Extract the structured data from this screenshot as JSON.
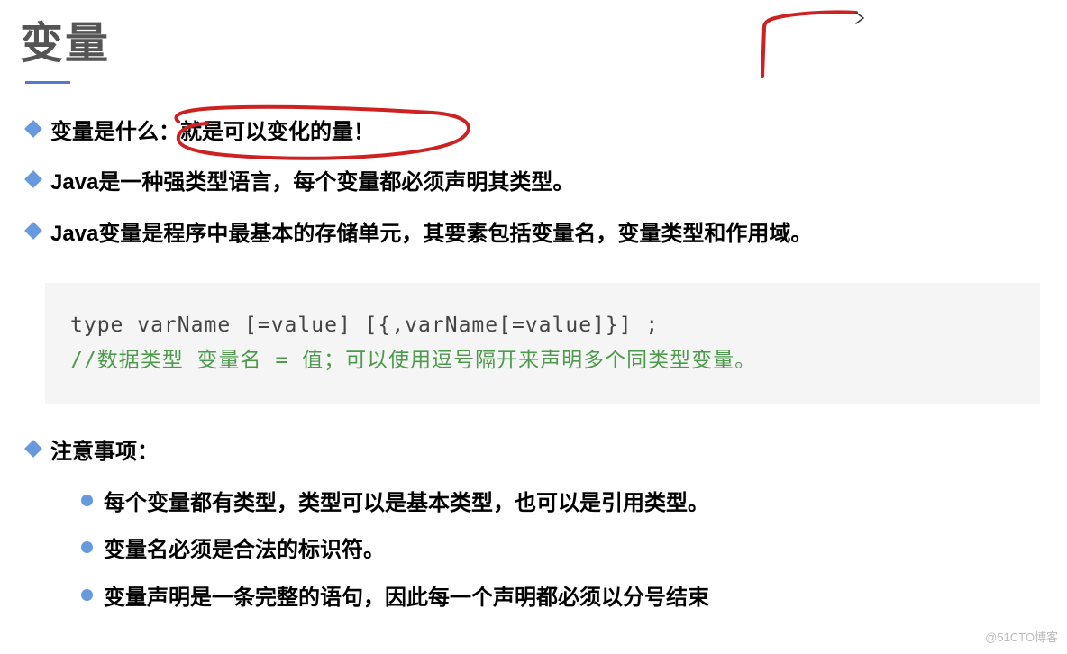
{
  "title": "变量",
  "bullets": [
    "变量是什么：就是可以变化的量！",
    "Java是一种强类型语言，每个变量都必须声明其类型。",
    "Java变量是程序中最基本的存储单元，其要素包括变量名，变量类型和作用域。"
  ],
  "code": {
    "line1": "type varName  [=value] [{,varName[=value]}] ;",
    "comment": "//数据类型  变量名 = 值；可以使用逗号隔开来声明多个同类型变量。"
  },
  "notes_heading": "注意事项：",
  "notes": [
    "每个变量都有类型，类型可以是基本类型，也可以是引用类型。",
    "变量名必须是合法的标识符。",
    "变量声明是一条完整的语句，因此每一个声明都必须以分号结束"
  ],
  "watermark": "@51CTO博客"
}
